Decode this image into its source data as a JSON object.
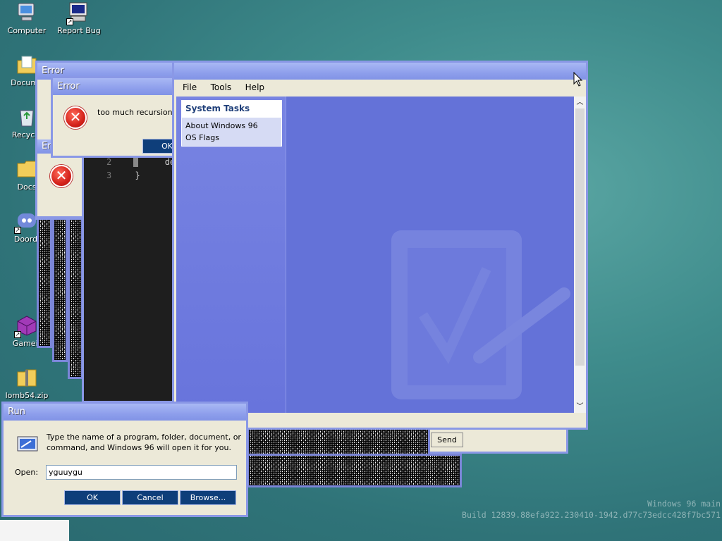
{
  "desktop": {
    "icons": [
      {
        "label": "Computer"
      },
      {
        "label": "Report Bug"
      },
      {
        "label": "Docume"
      },
      {
        "label": "Recycle"
      },
      {
        "label": "Docs"
      },
      {
        "label": "Doordi"
      },
      {
        "label": "Gameir"
      },
      {
        "label": "lomb54.zip"
      }
    ],
    "watermark_line1": "Windows 96 main",
    "watermark_line2": "Build 12839.88efa922.230410-1942.d77c73edcc428f7bc571"
  },
  "error_back": {
    "title": "Error"
  },
  "error_mid": {
    "title": "Err"
  },
  "error_front": {
    "title": "Error",
    "message": "too much recursion",
    "ok_label": "OK"
  },
  "code_editor": {
    "lines": [
      {
        "num": "2",
        "text": "des"
      },
      {
        "num": "3",
        "text": "}"
      }
    ]
  },
  "main_window": {
    "title": "",
    "menu": [
      "File",
      "Tools",
      "Help"
    ],
    "system_tasks": {
      "heading": "System Tasks",
      "items": [
        "About Windows 96",
        "OS Flags"
      ]
    }
  },
  "mail_window": {
    "send_label": "Send"
  },
  "run_dialog": {
    "title": "Run",
    "description": "Type the name of a program, folder, document, or command, and Windows 96 will open it for you.",
    "open_label": "Open:",
    "open_value": "yguuygu",
    "ok_label": "OK",
    "cancel_label": "Cancel",
    "browse_label": "Browse..."
  },
  "colors": {
    "accent": "#8a98e6",
    "task_panel": "#6472d8",
    "button": "#0e3e7a"
  }
}
